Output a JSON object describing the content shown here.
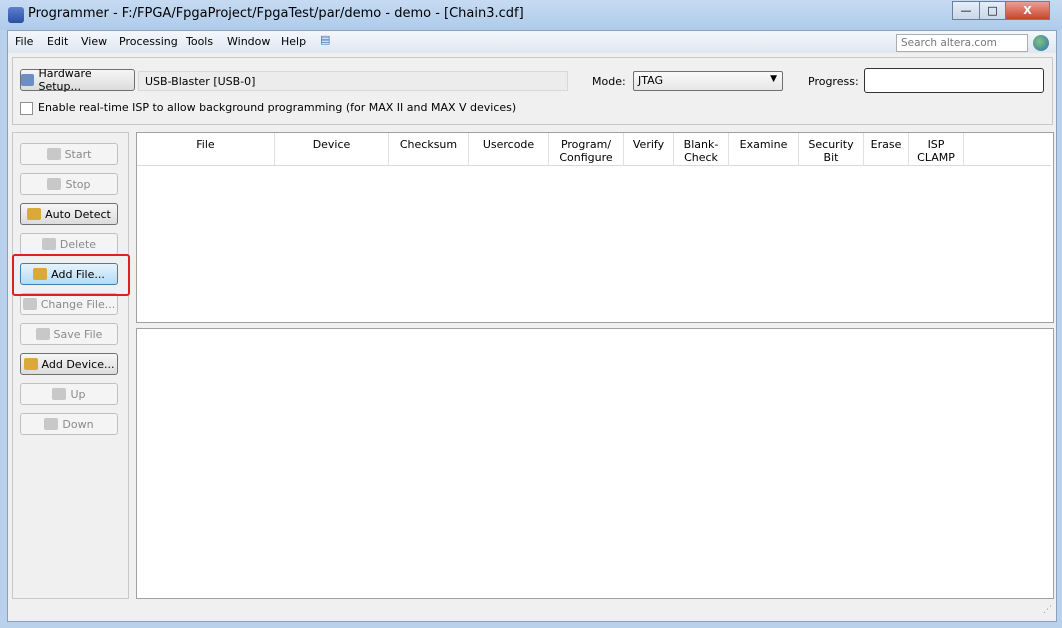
{
  "window": {
    "title": "Programmer - F:/FPGA/FpgaProject/FpgaTest/par/demo - demo - [Chain3.cdf]",
    "minimize": "—",
    "maximize": "□",
    "close": "X"
  },
  "menu": [
    "File",
    "Edit",
    "View",
    "Processing",
    "Tools",
    "Window",
    "Help"
  ],
  "search": {
    "placeholder": "Search altera.com"
  },
  "hardware": {
    "button": "Hardware Setup...",
    "value": "USB-Blaster [USB-0]"
  },
  "mode": {
    "label": "Mode:",
    "value": "JTAG"
  },
  "progress": {
    "label": "Progress:"
  },
  "isp": {
    "label": "Enable real-time ISP to allow background programming (for MAX II and MAX V devices)",
    "checked": false
  },
  "buttons": [
    {
      "label": "Start",
      "enabled": false,
      "icon": "start-icon"
    },
    {
      "label": "Stop",
      "enabled": false,
      "icon": "stop-icon"
    },
    {
      "label": "Auto Detect",
      "enabled": true,
      "icon": "auto-detect-icon"
    },
    {
      "label": "Delete",
      "enabled": false,
      "icon": "delete-icon"
    },
    {
      "label": "Add File...",
      "enabled": true,
      "icon": "folder-open-icon",
      "highlighted": true
    },
    {
      "label": "Change File...",
      "enabled": false,
      "icon": "change-file-icon"
    },
    {
      "label": "Save File",
      "enabled": false,
      "icon": "save-icon"
    },
    {
      "label": "Add Device...",
      "enabled": true,
      "icon": "add-device-icon"
    },
    {
      "label": "Up",
      "enabled": false,
      "icon": "up-arrow-icon"
    },
    {
      "label": "Down",
      "enabled": false,
      "icon": "down-arrow-icon"
    }
  ],
  "table": {
    "columns": [
      "File",
      "Device",
      "Checksum",
      "Usercode",
      "Program/\nConfigure",
      "Verify",
      "Blank-\nCheck",
      "Examine",
      "Security\nBit",
      "Erase",
      "ISP\nCLAMP"
    ],
    "rows": []
  },
  "colors": {
    "highlight_box": "#e02020",
    "titlebar": "#b9d1ea"
  }
}
